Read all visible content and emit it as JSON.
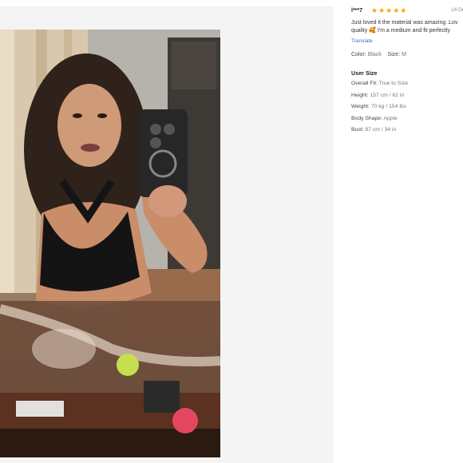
{
  "review": {
    "reviewer": "l***7",
    "rating": 5,
    "stars": "★★★★★",
    "date": "14 De",
    "text": "Just loved it the material was amazing .Lov\nquality 🥰 I'm a medium and fit perfectly",
    "translate_label": "Translate",
    "color_label": "Color:",
    "color_value": "Black",
    "size_label": "Size:",
    "size_value": "M"
  },
  "user_size": {
    "title": "User Size",
    "items": [
      {
        "label": "Overall Fit:",
        "value": "True to Size"
      },
      {
        "label": "Height:",
        "value": "157 cm / 62 in"
      },
      {
        "label": "Weight:",
        "value": "70 kg / 154 lbs"
      },
      {
        "label": "Body Shape:",
        "value": "Apple"
      },
      {
        "label": "Bust:",
        "value": "87 cm / 34 in"
      }
    ]
  },
  "colors": {
    "star": "#f6a609",
    "link": "#2e6fd9",
    "panel_bg": "#f4f4f4"
  }
}
